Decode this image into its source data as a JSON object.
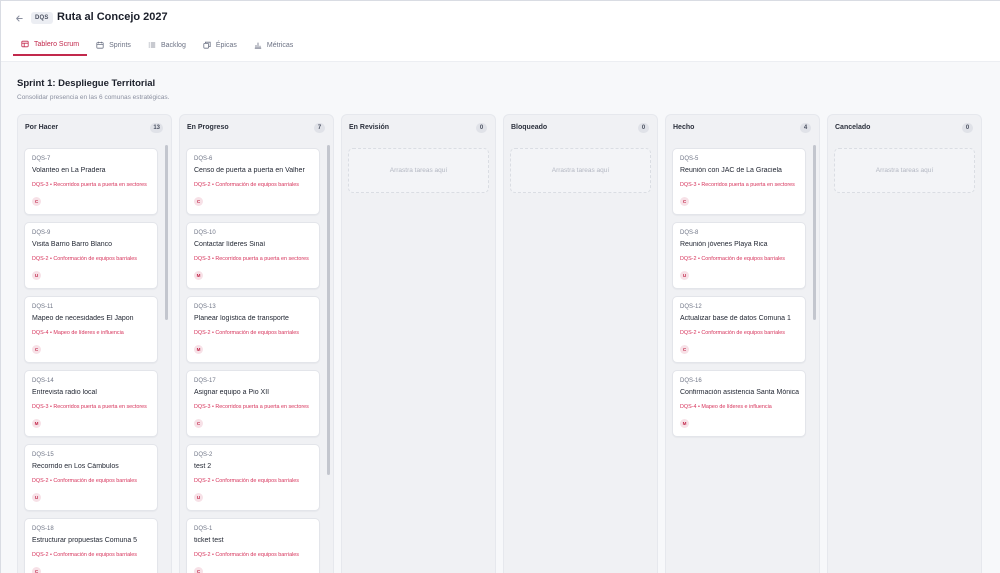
{
  "header": {
    "back_icon": "arrow-left-icon",
    "code": "DQS",
    "title": "Ruta al Concejo 2027"
  },
  "tabs": [
    {
      "label": "Tablero Scrum",
      "icon": "board-icon",
      "active": true
    },
    {
      "label": "Sprints",
      "icon": "calendar-icon",
      "active": false
    },
    {
      "label": "Backlog",
      "icon": "list-icon",
      "active": false
    },
    {
      "label": "Épicas",
      "icon": "layers-icon",
      "active": false
    },
    {
      "label": "Métricas",
      "icon": "chart-icon",
      "active": false
    }
  ],
  "sprint": {
    "title": "Sprint 1: Despliegue Territorial",
    "description": "Consolidar presencia en las 6 comunas estratégicas."
  },
  "colors": {
    "accent": "#c2294c",
    "epic_text": "#d6325a"
  },
  "dropzone_text": "Arrastra tareas aquí",
  "columns": [
    {
      "title": "Por Hacer",
      "count": "13",
      "cards": [
        {
          "id": "DQS-7",
          "title": "Volanteo en La Pradera",
          "epic": "DQS-3 • Recorridos puerta a puerta en sectores",
          "avatar": "C"
        },
        {
          "id": "DQS-9",
          "title": "Visita Barrio Barro Blanco",
          "epic": "DQS-2 • Conformación de equipos barriales",
          "avatar": "U"
        },
        {
          "id": "DQS-11",
          "title": "Mapeo de necesidades El Japon",
          "epic": "DQS-4 • Mapeo de líderes e influencia",
          "avatar": "C"
        },
        {
          "id": "DQS-14",
          "title": "Entrevista radio local",
          "epic": "DQS-3 • Recorridos puerta a puerta en sectores",
          "avatar": "M"
        },
        {
          "id": "DQS-15",
          "title": "Recorrido en Los Cámbulos",
          "epic": "DQS-2 • Conformación de equipos barriales",
          "avatar": "U"
        },
        {
          "id": "DQS-18",
          "title": "Estructurar propuestas Comuna 5",
          "epic": "DQS-2 • Conformación de equipos barriales",
          "avatar": "C"
        }
      ]
    },
    {
      "title": "En Progreso",
      "count": "7",
      "cards": [
        {
          "id": "DQS-6",
          "title": "Censo de puerta a puerta en Valher",
          "epic": "DQS-2 • Conformación de equipos barriales",
          "avatar": "C"
        },
        {
          "id": "DQS-10",
          "title": "Contactar líderes Sinaí",
          "epic": "DQS-3 • Recorridos puerta a puerta en sectores",
          "avatar": "M"
        },
        {
          "id": "DQS-13",
          "title": "Planear logística de transporte",
          "epic": "DQS-2 • Conformación de equipos barriales",
          "avatar": "M"
        },
        {
          "id": "DQS-17",
          "title": "Asignar equipo a Pio XII",
          "epic": "DQS-3 • Recorridos puerta a puerta en sectores",
          "avatar": "C"
        },
        {
          "id": "DQS-2",
          "title": "test 2",
          "epic": "DQS-2 • Conformación de equipos barriales",
          "avatar": "U"
        },
        {
          "id": "DQS-1",
          "title": "ticket test",
          "epic": "DQS-2 • Conformación de equipos barriales",
          "avatar": "C"
        }
      ]
    },
    {
      "title": "En Revisión",
      "count": "0",
      "cards": []
    },
    {
      "title": "Bloqueado",
      "count": "0",
      "cards": []
    },
    {
      "title": "Hecho",
      "count": "4",
      "cards": [
        {
          "id": "DQS-5",
          "title": "Reunión con JAC de La Graciela",
          "epic": "DQS-3 • Recorridos puerta a puerta en sectores",
          "avatar": "C"
        },
        {
          "id": "DQS-8",
          "title": "Reunión jóvenes Playa Rica",
          "epic": "DQS-2 • Conformación de equipos barriales",
          "avatar": "U"
        },
        {
          "id": "DQS-12",
          "title": "Actualizar base de datos Comuna 1",
          "epic": "DQS-2 • Conformación de equipos barriales",
          "avatar": "C"
        },
        {
          "id": "DQS-16",
          "title": "Confirmación asistencia Santa Mónica",
          "epic": "DQS-4 • Mapeo de líderes e influencia",
          "avatar": "M"
        }
      ]
    },
    {
      "title": "Cancelado",
      "count": "0",
      "cards": []
    }
  ]
}
